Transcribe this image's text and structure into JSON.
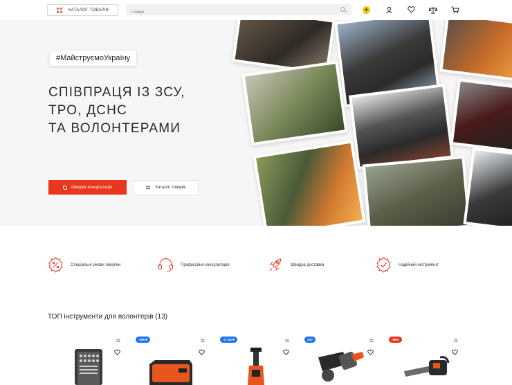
{
  "header": {
    "catalog_label": "КАТАЛОГ ТОВАРІВ",
    "search_placeholder": "Пошук",
    "coin_label": "₴"
  },
  "hero": {
    "hashtag": "#МайструємоУкраїну",
    "title_lines": [
      "СПІВПРАЦЯ ІЗ ЗСУ,",
      "ТРО, ДСНС",
      "ТА ВОЛОНТЕРАМИ"
    ],
    "primary_button": "Швидка консультація",
    "secondary_button": "Каталог товарів"
  },
  "features": [
    {
      "label": "Спеціальні умови покупки",
      "icon": "percent-badge-icon"
    },
    {
      "label": "Професійна консультація",
      "icon": "headset-icon"
    },
    {
      "label": "Швидка доставка",
      "icon": "rocket-icon"
    },
    {
      "label": "Надійний інструмент",
      "icon": "check-badge-icon"
    }
  ],
  "products_section": {
    "title": "ТОП інструменти для волонтерів (13)",
    "cards": [
      {
        "badge": "",
        "badge_color": "",
        "icon": "tool-set-icon"
      },
      {
        "badge": "-495 ₴",
        "badge_color": "#1a73e8",
        "icon": "battery-icon"
      },
      {
        "badge": "-2 715 ₴",
        "badge_color": "#1a73e8",
        "icon": "pressure-washer-icon"
      },
      {
        "badge": "20V",
        "badge_color": "#1a73e8",
        "icon": "angle-grinder-icon"
      },
      {
        "badge": "-59%",
        "badge_color": "#e8361f",
        "icon": "chainsaw-icon"
      }
    ]
  },
  "colors": {
    "accent": "#e8361f",
    "blue_badge": "#1a73e8",
    "coin": "#f7c300"
  }
}
